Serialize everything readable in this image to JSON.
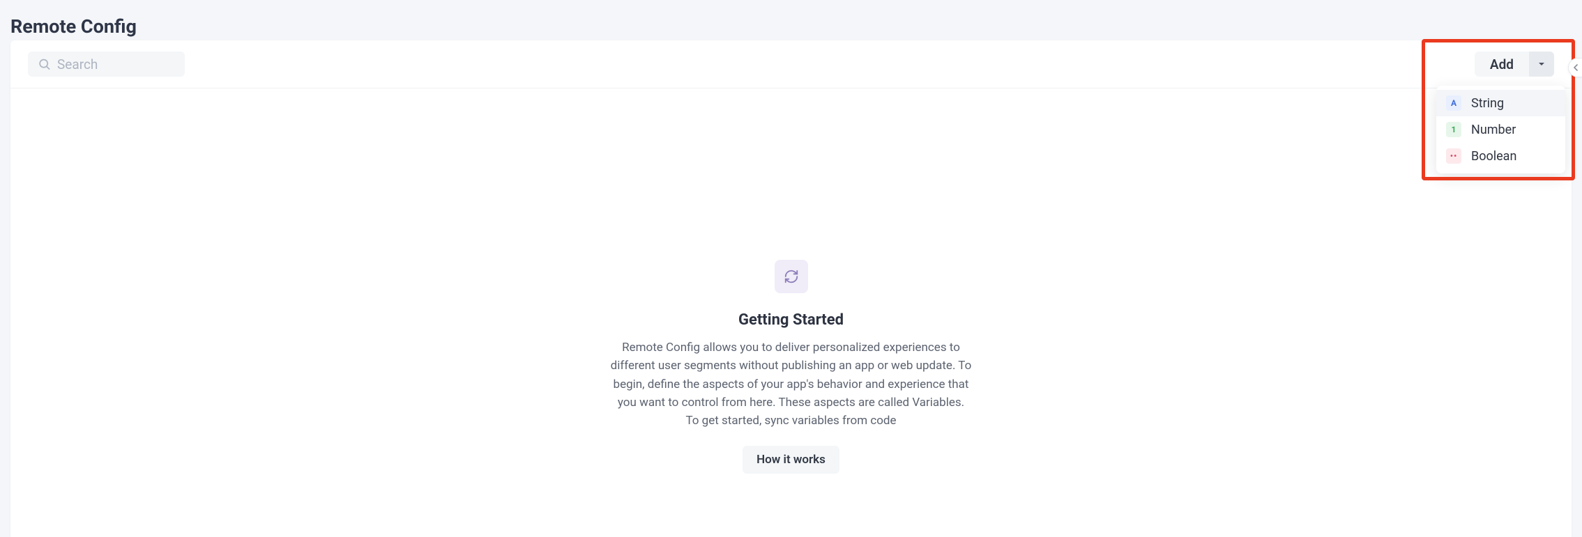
{
  "page": {
    "title": "Remote Config"
  },
  "toolbar": {
    "search_placeholder": "Search",
    "add_label": "Add"
  },
  "dropdown": {
    "items": [
      {
        "badge": "A",
        "label": "String",
        "type": "string"
      },
      {
        "badge": "1",
        "label": "Number",
        "type": "number"
      },
      {
        "badge": "••",
        "label": "Boolean",
        "type": "boolean"
      }
    ]
  },
  "empty": {
    "heading": "Getting Started",
    "body": "Remote Config allows you to deliver personalized experiences to different user segments without publishing an app or web update. To begin, define the aspects of your app's behavior and experience that you want to control from here. These aspects are called Variables. To get started, sync variables from code",
    "cta": "How it works"
  }
}
